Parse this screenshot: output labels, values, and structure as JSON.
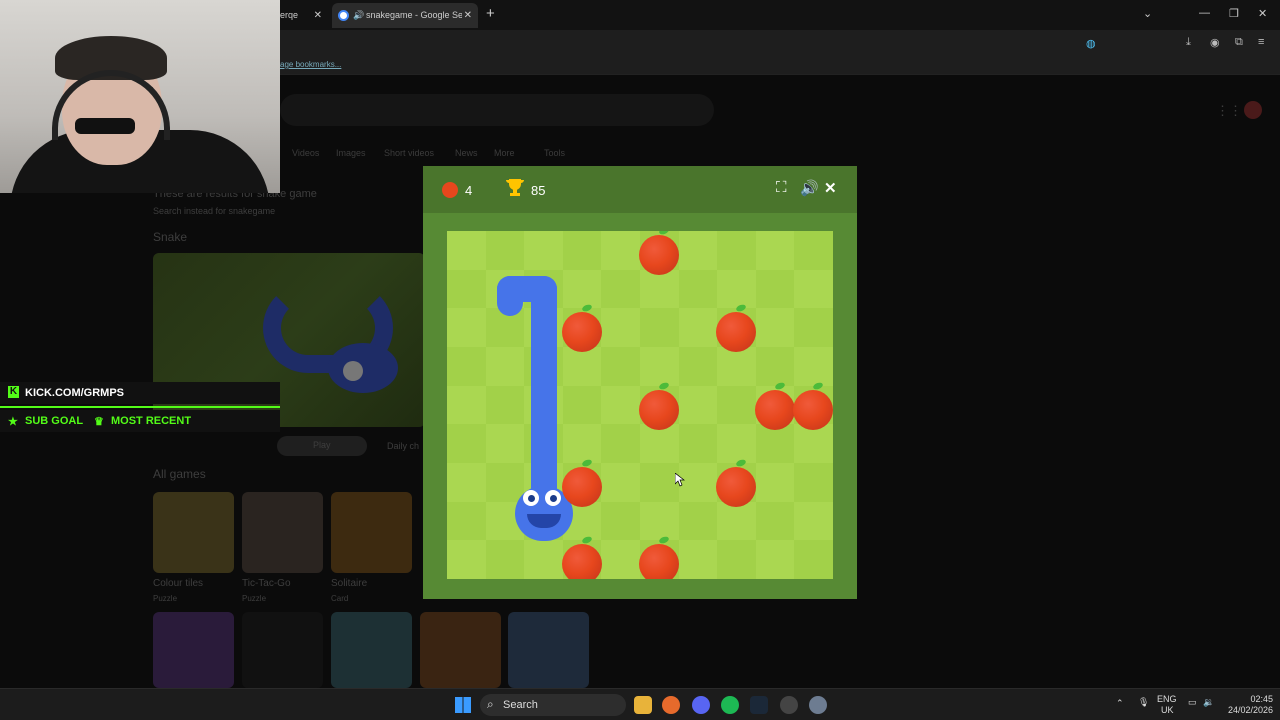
{
  "browser": {
    "tabs": [
      {
        "label": "erqe",
        "active": false
      },
      {
        "label": "snakegame - Google Search",
        "active": true
      }
    ],
    "bookmarks_text": "age bookmarks..."
  },
  "google": {
    "results_for": "These are results for snake game",
    "search_instead": "Search instead for snakegame",
    "section_title": "Snake",
    "play_label": "Play",
    "daily_label": "Daily ch",
    "all_games": "All games",
    "games": [
      {
        "name": "Colour tiles",
        "sub": "Puzzle"
      },
      {
        "name": "Tic-Tac-Go",
        "sub": "Puzzle"
      },
      {
        "name": "Solitaire",
        "sub": "Card"
      }
    ],
    "nav": [
      "Videos",
      "Images",
      "Short videos",
      "News",
      "More",
      "Tools"
    ]
  },
  "stream_overlay": {
    "kick": "KICK.COM/GRMPS",
    "sub_goal": "SUB GOAL",
    "most_recent": "MOST RECENT",
    "accent": "#53fc18"
  },
  "game": {
    "apples_eaten": "4",
    "high_score": "85",
    "colors": {
      "header": "#4a752c",
      "frame": "#578a34",
      "light": "#aad751",
      "dark": "#a2d149",
      "snake": "#4674e9",
      "apple": "#e7471d"
    },
    "icons": [
      "fullscreen-icon",
      "volume-icon",
      "close-icon"
    ]
  },
  "taskbar": {
    "search_label": "Search",
    "lang1": "ENG",
    "lang2": "UK",
    "time": "02:45",
    "date": "24/02/2026"
  }
}
